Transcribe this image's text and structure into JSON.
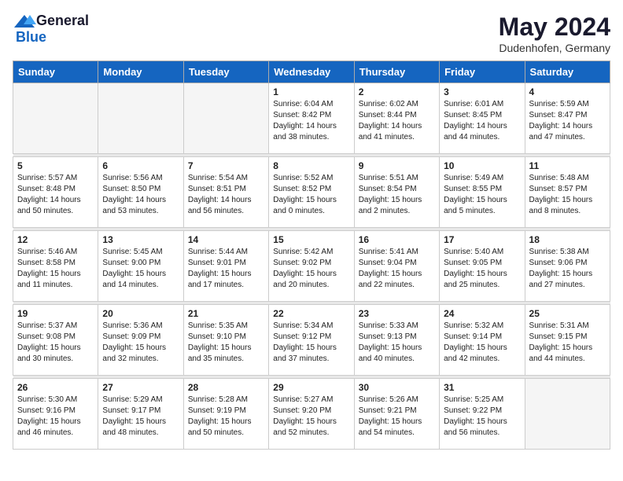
{
  "logo": {
    "general": "General",
    "blue": "Blue"
  },
  "header": {
    "month": "May 2024",
    "location": "Dudenhofen, Germany"
  },
  "weekdays": [
    "Sunday",
    "Monday",
    "Tuesday",
    "Wednesday",
    "Thursday",
    "Friday",
    "Saturday"
  ],
  "weeks": [
    [
      {
        "day": "",
        "info": ""
      },
      {
        "day": "",
        "info": ""
      },
      {
        "day": "",
        "info": ""
      },
      {
        "day": "1",
        "info": "Sunrise: 6:04 AM\nSunset: 8:42 PM\nDaylight: 14 hours\nand 38 minutes."
      },
      {
        "day": "2",
        "info": "Sunrise: 6:02 AM\nSunset: 8:44 PM\nDaylight: 14 hours\nand 41 minutes."
      },
      {
        "day": "3",
        "info": "Sunrise: 6:01 AM\nSunset: 8:45 PM\nDaylight: 14 hours\nand 44 minutes."
      },
      {
        "day": "4",
        "info": "Sunrise: 5:59 AM\nSunset: 8:47 PM\nDaylight: 14 hours\nand 47 minutes."
      }
    ],
    [
      {
        "day": "5",
        "info": "Sunrise: 5:57 AM\nSunset: 8:48 PM\nDaylight: 14 hours\nand 50 minutes."
      },
      {
        "day": "6",
        "info": "Sunrise: 5:56 AM\nSunset: 8:50 PM\nDaylight: 14 hours\nand 53 minutes."
      },
      {
        "day": "7",
        "info": "Sunrise: 5:54 AM\nSunset: 8:51 PM\nDaylight: 14 hours\nand 56 minutes."
      },
      {
        "day": "8",
        "info": "Sunrise: 5:52 AM\nSunset: 8:52 PM\nDaylight: 15 hours\nand 0 minutes."
      },
      {
        "day": "9",
        "info": "Sunrise: 5:51 AM\nSunset: 8:54 PM\nDaylight: 15 hours\nand 2 minutes."
      },
      {
        "day": "10",
        "info": "Sunrise: 5:49 AM\nSunset: 8:55 PM\nDaylight: 15 hours\nand 5 minutes."
      },
      {
        "day": "11",
        "info": "Sunrise: 5:48 AM\nSunset: 8:57 PM\nDaylight: 15 hours\nand 8 minutes."
      }
    ],
    [
      {
        "day": "12",
        "info": "Sunrise: 5:46 AM\nSunset: 8:58 PM\nDaylight: 15 hours\nand 11 minutes."
      },
      {
        "day": "13",
        "info": "Sunrise: 5:45 AM\nSunset: 9:00 PM\nDaylight: 15 hours\nand 14 minutes."
      },
      {
        "day": "14",
        "info": "Sunrise: 5:44 AM\nSunset: 9:01 PM\nDaylight: 15 hours\nand 17 minutes."
      },
      {
        "day": "15",
        "info": "Sunrise: 5:42 AM\nSunset: 9:02 PM\nDaylight: 15 hours\nand 20 minutes."
      },
      {
        "day": "16",
        "info": "Sunrise: 5:41 AM\nSunset: 9:04 PM\nDaylight: 15 hours\nand 22 minutes."
      },
      {
        "day": "17",
        "info": "Sunrise: 5:40 AM\nSunset: 9:05 PM\nDaylight: 15 hours\nand 25 minutes."
      },
      {
        "day": "18",
        "info": "Sunrise: 5:38 AM\nSunset: 9:06 PM\nDaylight: 15 hours\nand 27 minutes."
      }
    ],
    [
      {
        "day": "19",
        "info": "Sunrise: 5:37 AM\nSunset: 9:08 PM\nDaylight: 15 hours\nand 30 minutes."
      },
      {
        "day": "20",
        "info": "Sunrise: 5:36 AM\nSunset: 9:09 PM\nDaylight: 15 hours\nand 32 minutes."
      },
      {
        "day": "21",
        "info": "Sunrise: 5:35 AM\nSunset: 9:10 PM\nDaylight: 15 hours\nand 35 minutes."
      },
      {
        "day": "22",
        "info": "Sunrise: 5:34 AM\nSunset: 9:12 PM\nDaylight: 15 hours\nand 37 minutes."
      },
      {
        "day": "23",
        "info": "Sunrise: 5:33 AM\nSunset: 9:13 PM\nDaylight: 15 hours\nand 40 minutes."
      },
      {
        "day": "24",
        "info": "Sunrise: 5:32 AM\nSunset: 9:14 PM\nDaylight: 15 hours\nand 42 minutes."
      },
      {
        "day": "25",
        "info": "Sunrise: 5:31 AM\nSunset: 9:15 PM\nDaylight: 15 hours\nand 44 minutes."
      }
    ],
    [
      {
        "day": "26",
        "info": "Sunrise: 5:30 AM\nSunset: 9:16 PM\nDaylight: 15 hours\nand 46 minutes."
      },
      {
        "day": "27",
        "info": "Sunrise: 5:29 AM\nSunset: 9:17 PM\nDaylight: 15 hours\nand 48 minutes."
      },
      {
        "day": "28",
        "info": "Sunrise: 5:28 AM\nSunset: 9:19 PM\nDaylight: 15 hours\nand 50 minutes."
      },
      {
        "day": "29",
        "info": "Sunrise: 5:27 AM\nSunset: 9:20 PM\nDaylight: 15 hours\nand 52 minutes."
      },
      {
        "day": "30",
        "info": "Sunrise: 5:26 AM\nSunset: 9:21 PM\nDaylight: 15 hours\nand 54 minutes."
      },
      {
        "day": "31",
        "info": "Sunrise: 5:25 AM\nSunset: 9:22 PM\nDaylight: 15 hours\nand 56 minutes."
      },
      {
        "day": "",
        "info": ""
      }
    ]
  ]
}
